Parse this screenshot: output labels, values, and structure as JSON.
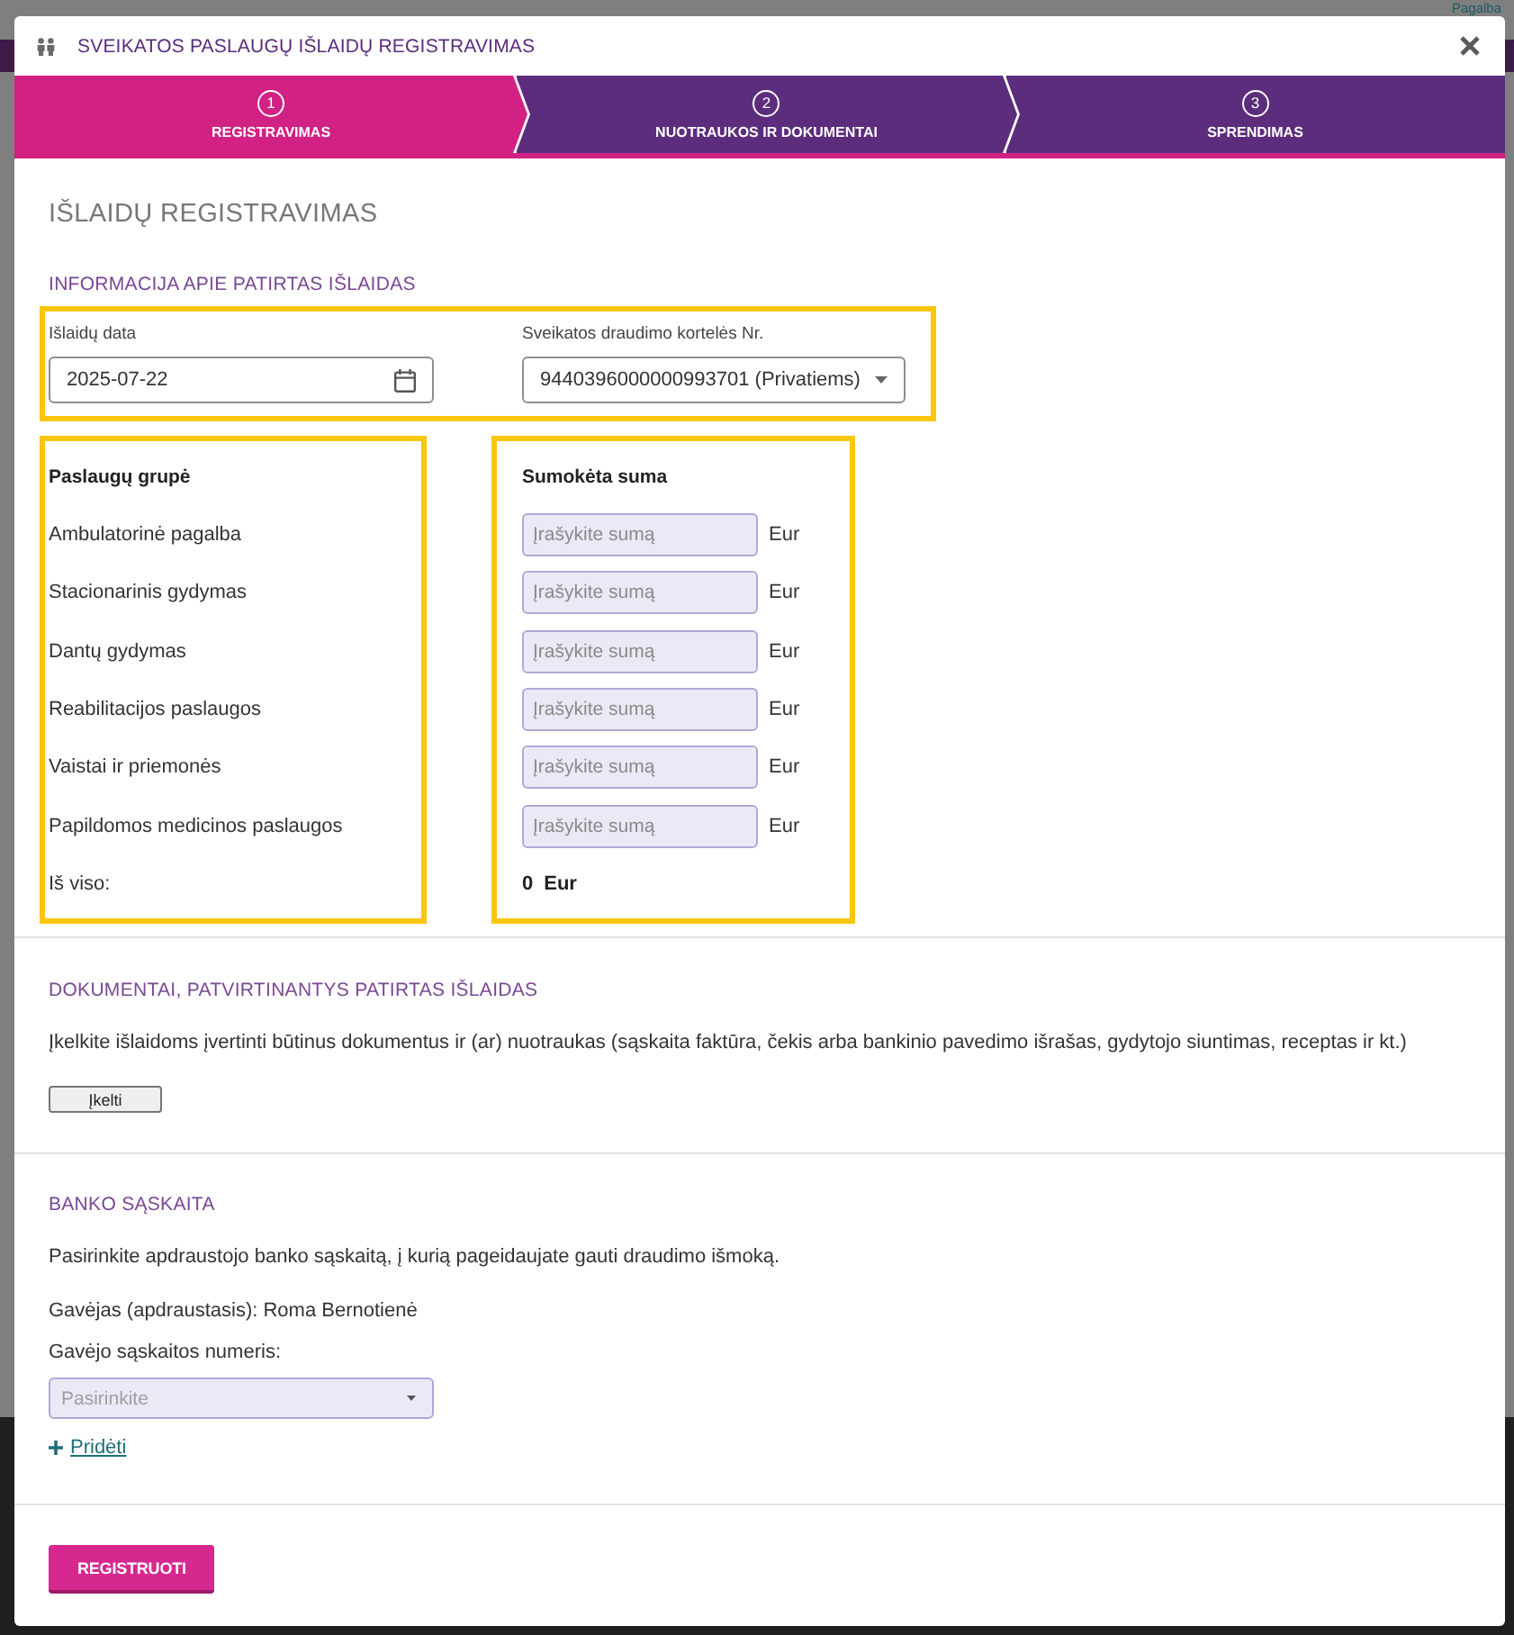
{
  "top_bar": {
    "help_link": "Pagalba"
  },
  "dialog": {
    "title": "SVEIKATOS PASLAUGŲ IŠLAIDŲ REGISTRAVIMAS"
  },
  "steps": [
    {
      "number": "1",
      "label": "REGISTRAVIMAS",
      "selected": true
    },
    {
      "number": "2",
      "label": "NUOTRAUKOS IR DOKUMENTAI",
      "selected": false
    },
    {
      "number": "3",
      "label": "SPRENDIMAS",
      "selected": false
    }
  ],
  "expenses": {
    "heading": "IŠLAIDŲ REGISTRAVIMAS",
    "section_title": "INFORMACIJA APIE PATIRTAS IŠLAIDAS",
    "highlighted": true,
    "date_field": {
      "label": "Išlaidų data",
      "value": "2025-07-22"
    },
    "card_field": {
      "label": "Sveikatos draudimo kortelės Nr.",
      "value": "9440396000000993701 (Privatiems)"
    }
  },
  "services": {
    "highlighted": true,
    "group_header": "Paslaugų grupė",
    "amount_header": "Sumokėta suma",
    "rows": [
      {
        "name": "Ambulatorinė pagalba",
        "placeholder": "Įrašykite sumą",
        "currency": "Eur"
      },
      {
        "name": "Stacionarinis gydymas",
        "placeholder": "Įrašykite sumą",
        "currency": "Eur"
      },
      {
        "name": "Dantų gydymas",
        "placeholder": "Įrašykite sumą",
        "currency": "Eur"
      },
      {
        "name": "Reabilitacijos paslaugos",
        "placeholder": "Įrašykite sumą",
        "currency": "Eur"
      },
      {
        "name": "Vaistai ir priemonės",
        "placeholder": "Įrašykite sumą",
        "currency": "Eur"
      },
      {
        "name": "Papildomos medicinos paslaugos",
        "placeholder": "Įrašykite sumą",
        "currency": "Eur"
      }
    ],
    "total": {
      "label": "Iš viso:",
      "value": "0",
      "currency": "Eur"
    }
  },
  "documents": {
    "title": "DOKUMENTAI, PATVIRTINANTYS PATIRTAS IŠLAIDAS",
    "text": "Įkelkite išlaidoms įvertinti būtinus dokumentus ir (ar) nuotraukas (sąskaita faktūra, čekis arba bankinio pavedimo išrašas, gydytojo siuntimas, receptas ir kt.)",
    "upload_button": "Įkelti"
  },
  "bank": {
    "title": "BANKO SĄSKAITA",
    "text": "Pasirinkite apdraustojo banko sąskaitą, į kurią pageidaujate gauti draudimo išmoką.",
    "recipient": "Gavėjas (apdraustasis): Roma Bernotienė",
    "account_label": "Gavėjo sąskaitos numeris:",
    "account_select": {
      "placeholder": "Pasirinkite"
    },
    "add_link": "Pridėti"
  },
  "submit_button": "REGISTRUOTI"
}
